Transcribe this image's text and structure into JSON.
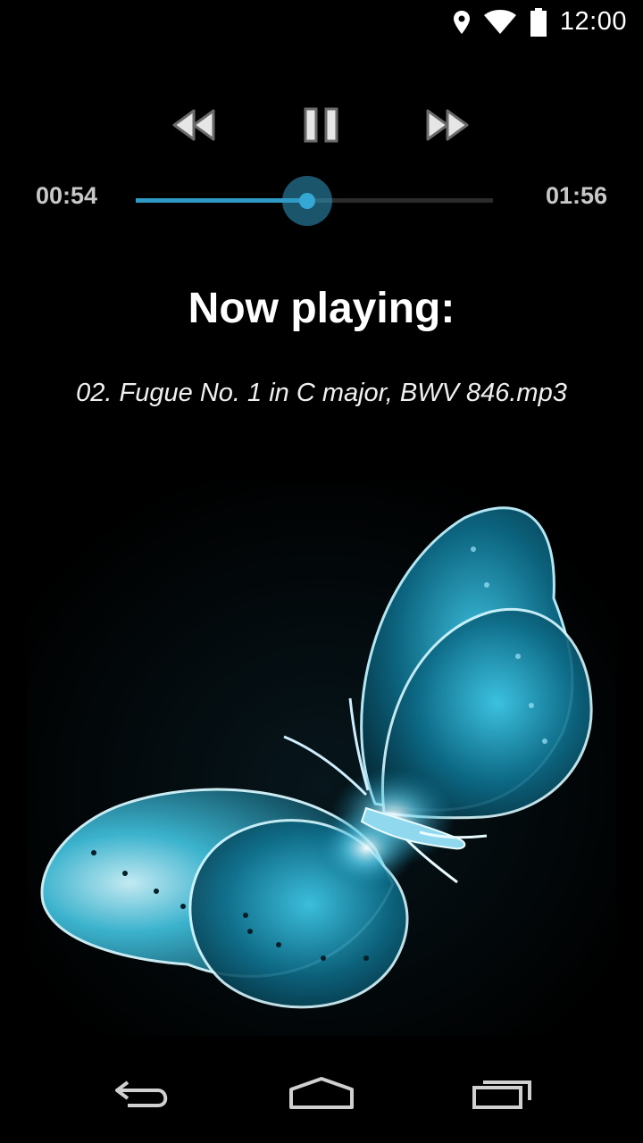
{
  "status_bar": {
    "time": "12:00"
  },
  "player": {
    "elapsed": "00:54",
    "total": "01:56",
    "progress": 0.48,
    "accent_color": "#2f9bc5",
    "now_playing_label": "Now playing:",
    "track_name": "02. Fugue No. 1 in C major, BWV 846.mp3"
  },
  "icons": {
    "rewind": "rewind-icon",
    "pause": "pause-icon",
    "fast_forward": "fast-forward-icon",
    "back": "back-icon",
    "home": "home-icon",
    "recents": "recents-icon"
  }
}
